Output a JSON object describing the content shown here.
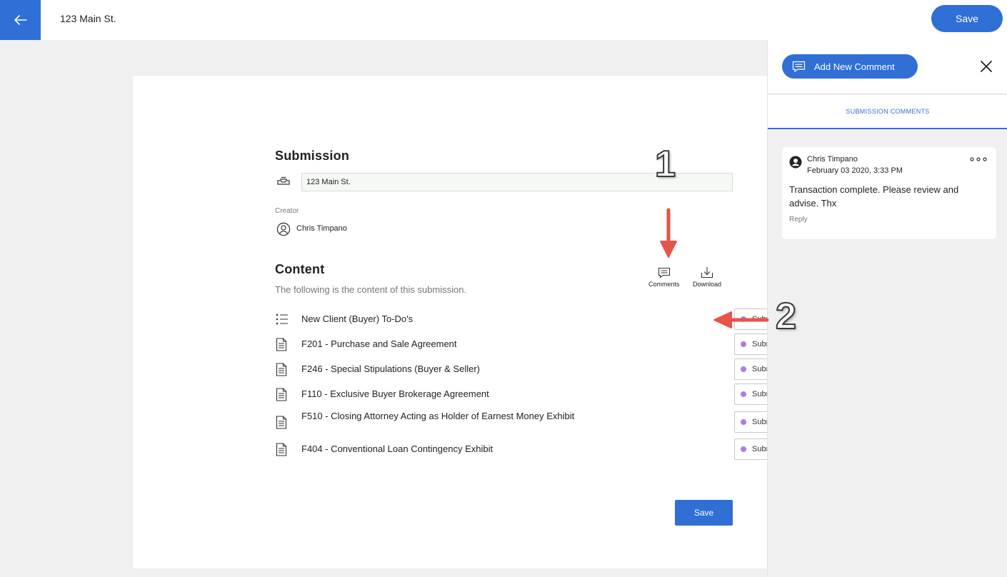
{
  "header": {
    "title": "123 Main St.",
    "save_label": "Save"
  },
  "submission": {
    "section_title": "Submission",
    "name_value": "123 Main St.",
    "creator_label": "Creator",
    "creator_name": "Chris Timpano"
  },
  "content": {
    "section_title": "Content",
    "description": "The following is the content of this submission.",
    "comments_label": "Comments",
    "download_label": "Download",
    "items": [
      {
        "title": "New Client (Buyer) To-Do's",
        "status": "Submitted",
        "icon": "checklist-icon"
      },
      {
        "title": "F201 - Purchase and Sale Agreement",
        "status": "Submitted",
        "icon": "document-icon"
      },
      {
        "title": "F246 - Special Stipulations (Buyer & Seller)",
        "status": "Submitted",
        "icon": "document-icon"
      },
      {
        "title": "F110 - Exclusive Buyer Brokerage Agreement",
        "status": "Submitted",
        "icon": "document-icon"
      },
      {
        "title": "F510 - Closing Attorney Acting as Holder of Earnest Money Exhibit",
        "status": "Submitted",
        "icon": "document-icon"
      },
      {
        "title": "F404 - Conventional Loan Contingency Exhibit",
        "status": "Submitted",
        "icon": "document-icon"
      }
    ],
    "save_label": "Save"
  },
  "panel": {
    "add_comment_label": "Add New Comment",
    "tab_label": "SUBMISSION COMMENTS",
    "comments": [
      {
        "author": "Chris Timpano",
        "date": "February 03 2020, 3:33 PM",
        "text": "Transaction complete. Please review and advise. Thx",
        "reply_label": "Reply"
      }
    ]
  },
  "annotations": {
    "marker_1": "1",
    "marker_2": "2"
  },
  "colors": {
    "primary": "#2f6fd6",
    "status_dot": "#b07ce0",
    "arrow": "#e8534a",
    "background": "#f0f0f0"
  }
}
